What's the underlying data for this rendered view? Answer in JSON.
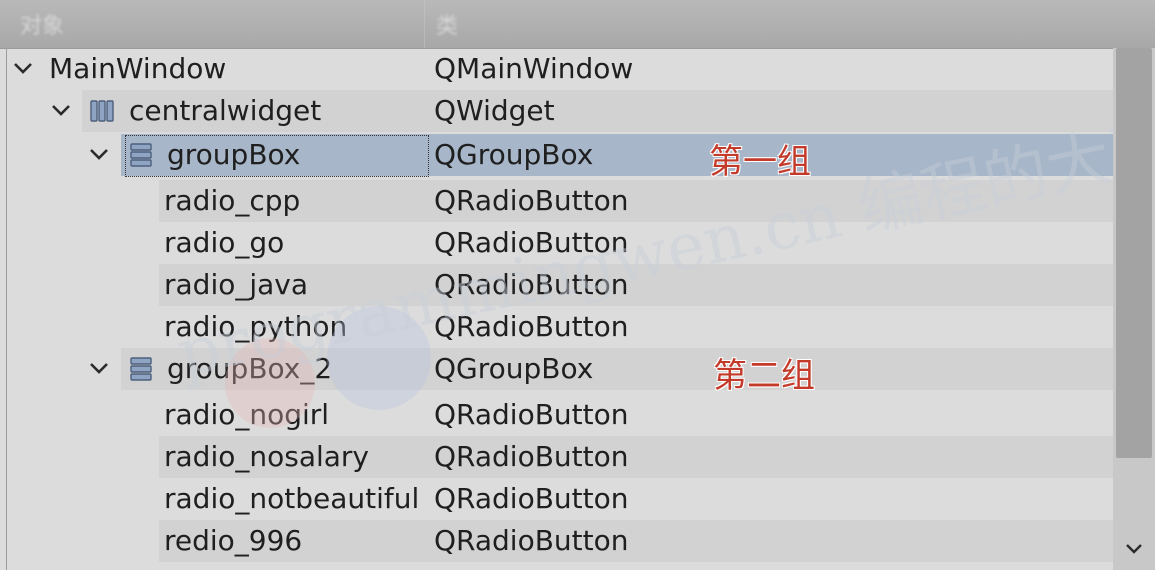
{
  "header": {
    "col_object": "对象",
    "col_class": "类"
  },
  "rows": [
    {
      "name": "MainWindow",
      "class": "QMainWindow",
      "icon": "none",
      "expanded": true
    },
    {
      "name": "centralwidget",
      "class": "QWidget",
      "icon": "horizontal-layout-icon",
      "expanded": true
    },
    {
      "name": "groupBox",
      "class": "QGroupBox",
      "icon": "vertical-layout-icon",
      "expanded": true,
      "selected": true
    },
    {
      "name": "radio_cpp",
      "class": "QRadioButton"
    },
    {
      "name": "radio_go",
      "class": "QRadioButton"
    },
    {
      "name": "radio_java",
      "class": "QRadioButton"
    },
    {
      "name": "radio_python",
      "class": "QRadioButton"
    },
    {
      "name": "groupBox_2",
      "class": "QGroupBox",
      "icon": "vertical-layout-icon",
      "expanded": true
    },
    {
      "name": "radio_nogirl",
      "class": "QRadioButton"
    },
    {
      "name": "radio_nosalary",
      "class": "QRadioButton"
    },
    {
      "name": "radio_notbeautiful",
      "class": "QRadioButton"
    },
    {
      "name": "redio_996",
      "class": "QRadioButton"
    }
  ],
  "annotations": {
    "group1": "第一组",
    "group2": "第二组"
  },
  "watermark": {
    "text": "programmingwen.cn 编程的大丙"
  },
  "colors": {
    "selection": "#a7b6c9",
    "annotation": "#c43a2a"
  }
}
